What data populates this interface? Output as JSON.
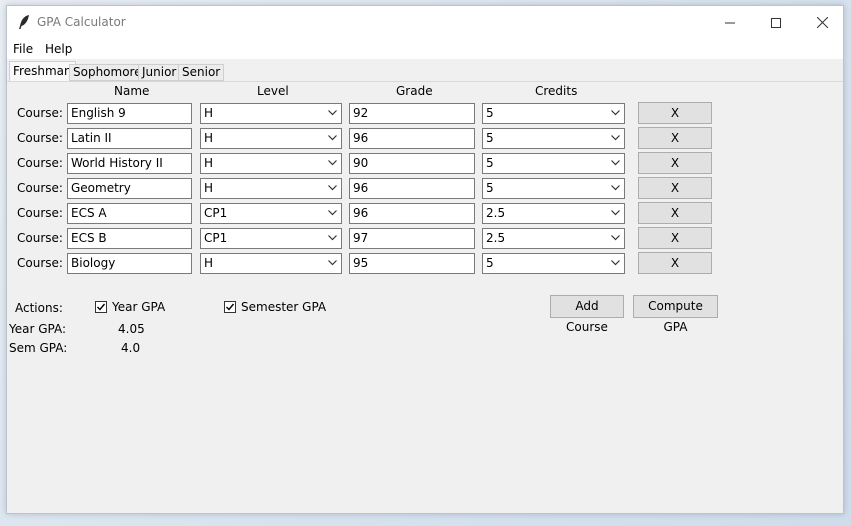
{
  "window": {
    "title": "GPA Calculator"
  },
  "menu": {
    "file": "File",
    "help": "Help"
  },
  "tabs": [
    {
      "label": "Freshman",
      "active": true
    },
    {
      "label": "Sophomore",
      "active": false
    },
    {
      "label": "Junior",
      "active": false
    },
    {
      "label": "Senior",
      "active": false
    }
  ],
  "columns": {
    "name": "Name",
    "level": "Level",
    "grade": "Grade",
    "credits": "Credits"
  },
  "row_label": "Course:",
  "remove_label": "X",
  "courses": [
    {
      "name": "English 9",
      "level": "H",
      "grade": "92",
      "credits": "5"
    },
    {
      "name": "Latin II",
      "level": "H",
      "grade": "96",
      "credits": "5"
    },
    {
      "name": "World History II",
      "level": "H",
      "grade": "90",
      "credits": "5"
    },
    {
      "name": "Geometry",
      "level": "H",
      "grade": "96",
      "credits": "5"
    },
    {
      "name": "ECS A",
      "level": "CP1",
      "grade": "96",
      "credits": "2.5"
    },
    {
      "name": "ECS B",
      "level": "CP1",
      "grade": "97",
      "credits": "2.5"
    },
    {
      "name": "Biology",
      "level": "H",
      "grade": "95",
      "credits": "5"
    }
  ],
  "actions": {
    "label": "Actions:",
    "year_gpa_check": {
      "label": "Year GPA",
      "checked": true
    },
    "semester_gpa_check": {
      "label": "Semester GPA",
      "checked": true
    },
    "add_course": "Add Course",
    "compute_gpa": "Compute GPA"
  },
  "results": {
    "year_label": "Year GPA:",
    "year_value": "4.05",
    "sem_label": "Sem GPA:",
    "sem_value": "4.0"
  }
}
